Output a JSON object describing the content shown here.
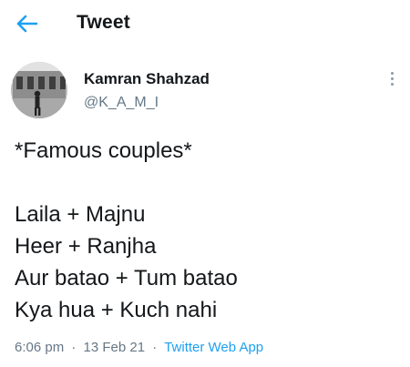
{
  "header": {
    "title": "Tweet",
    "back_icon": "arrow-left-icon"
  },
  "colors": {
    "accent": "#1da1f2",
    "text": "#14171a",
    "secondary": "#657786"
  },
  "tweet": {
    "author_name": "Kamran Shahzad",
    "author_handle": "@K_A_M_I",
    "more_icon": "more-vertical-icon",
    "lines": [
      "*Famous couples*",
      "",
      "Laila + Majnu",
      "Heer + Ranjha",
      "Aur batao + Tum batao",
      "Kya hua + Kuch nahi"
    ],
    "time": "6:06 pm",
    "date": "13 Feb 21",
    "separator": "·",
    "source": "Twitter Web App"
  }
}
